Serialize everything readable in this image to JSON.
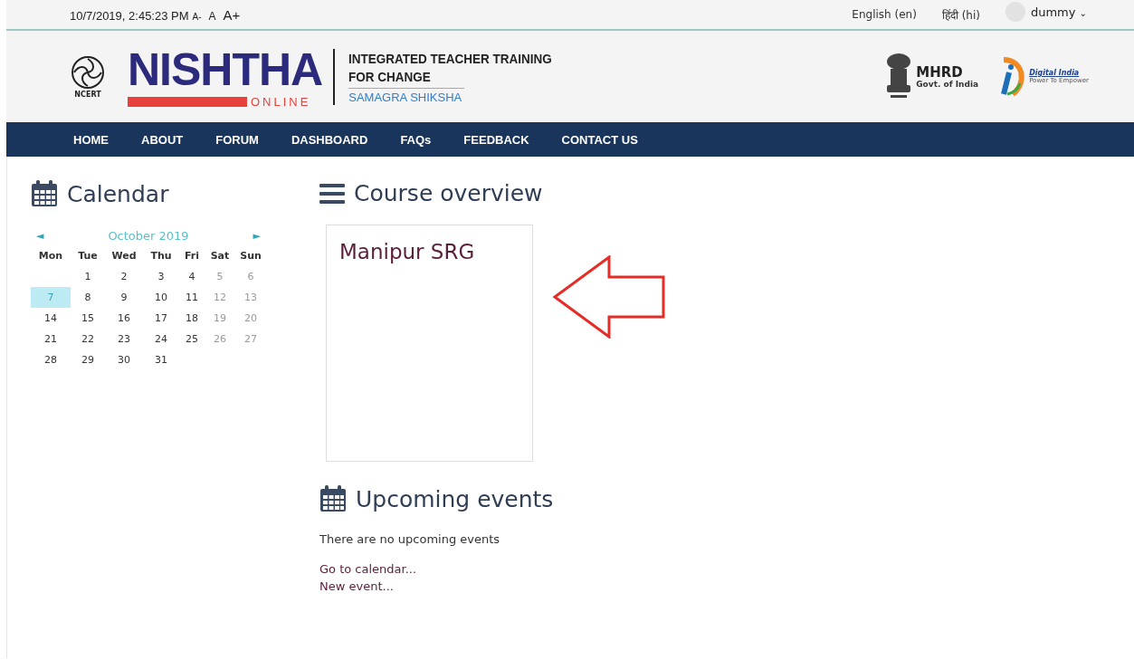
{
  "top_bar": {
    "datetime": "10/7/2019, 2:45:23 PM",
    "font_sizes": [
      "A-",
      "A",
      "A+"
    ],
    "languages": [
      "English (en)",
      "हिंदी (hi)"
    ],
    "user": {
      "name": "dummy",
      "caret": "⌄"
    }
  },
  "header": {
    "ncert_label": "NCERT",
    "brand": "NISHTHA",
    "brand_sub": "ONLINE",
    "tagline": [
      "INTEGRATED TEACHER TRAINING",
      "FOR CHANGE"
    ],
    "program": "SAMAGRA SHIKSHA",
    "mhrd": {
      "title": "MHRD",
      "subtitle": "Govt. of India"
    },
    "digital_india": {
      "title": "Digital India",
      "subtitle": "Power To Empower"
    }
  },
  "nav": [
    {
      "label": "HOME"
    },
    {
      "label": "ABOUT"
    },
    {
      "label": "FORUM"
    },
    {
      "label": "DASHBOARD"
    },
    {
      "label": "FAQs"
    },
    {
      "label": "FEEDBACK"
    },
    {
      "label": "CONTACT US"
    }
  ],
  "calendar": {
    "title": "Calendar",
    "prev": "◄",
    "month": "October 2019",
    "next": "►",
    "weekdays": [
      "Mon",
      "Tue",
      "Wed",
      "Thu",
      "Fri",
      "Sat",
      "Sun"
    ],
    "weeks": [
      [
        {
          "day": "1",
          "weekend": false,
          "today": false
        },
        {
          "day": "2",
          "weekend": false,
          "today": false
        },
        {
          "day": "3",
          "weekend": false,
          "today": false
        },
        {
          "day": "4",
          "weekend": false,
          "today": false
        },
        {
          "day": "5",
          "weekend": true,
          "today": false
        },
        {
          "day": "6",
          "weekend": true,
          "today": false
        }
      ],
      [
        {
          "day": "7",
          "weekend": false,
          "today": true
        },
        {
          "day": "8",
          "weekend": false,
          "today": false
        },
        {
          "day": "9",
          "weekend": false,
          "today": false
        },
        {
          "day": "10",
          "weekend": false,
          "today": false
        },
        {
          "day": "11",
          "weekend": false,
          "today": false
        },
        {
          "day": "12",
          "weekend": true,
          "today": false
        },
        {
          "day": "13",
          "weekend": true,
          "today": false
        }
      ],
      [
        {
          "day": "14",
          "weekend": false,
          "today": false
        },
        {
          "day": "15",
          "weekend": false,
          "today": false
        },
        {
          "day": "16",
          "weekend": false,
          "today": false
        },
        {
          "day": "17",
          "weekend": false,
          "today": false
        },
        {
          "day": "18",
          "weekend": false,
          "today": false
        },
        {
          "day": "19",
          "weekend": true,
          "today": false
        },
        {
          "day": "20",
          "weekend": true,
          "today": false
        }
      ],
      [
        {
          "day": "21",
          "weekend": false,
          "today": false
        },
        {
          "day": "22",
          "weekend": false,
          "today": false
        },
        {
          "day": "23",
          "weekend": false,
          "today": false
        },
        {
          "day": "24",
          "weekend": false,
          "today": false
        },
        {
          "day": "25",
          "weekend": false,
          "today": false
        },
        {
          "day": "26",
          "weekend": true,
          "today": false
        },
        {
          "day": "27",
          "weekend": true,
          "today": false
        }
      ],
      [
        {
          "day": "28",
          "weekend": false,
          "today": false
        },
        {
          "day": "29",
          "weekend": false,
          "today": false
        },
        {
          "day": "30",
          "weekend": false,
          "today": false
        },
        {
          "day": "31",
          "weekend": false,
          "today": false
        }
      ]
    ]
  },
  "course_overview": {
    "title": "Course overview",
    "courses": [
      {
        "name": "Manipur SRG"
      }
    ]
  },
  "upcoming_events": {
    "title": "Upcoming events",
    "message": "There are no upcoming events",
    "links": [
      "Go to calendar...",
      "New event..."
    ]
  }
}
